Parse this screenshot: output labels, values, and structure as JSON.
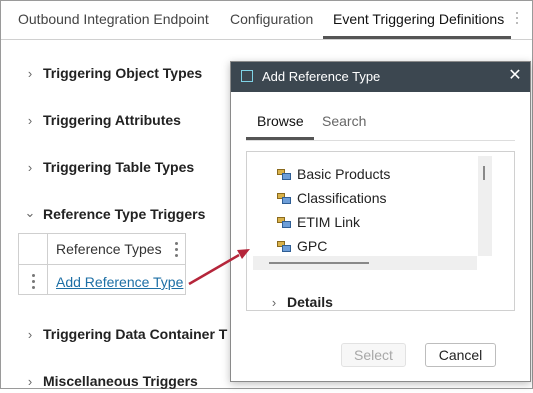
{
  "tabs": [
    {
      "label": "Outbound Integration Endpoint",
      "active": false
    },
    {
      "label": "Configuration",
      "active": false
    },
    {
      "label": "Event Triggering Definitions",
      "active": true
    }
  ],
  "sections": [
    {
      "label": "Triggering Object Types",
      "expanded": false
    },
    {
      "label": "Triggering Attributes",
      "expanded": false
    },
    {
      "label": "Triggering Table Types",
      "expanded": false
    },
    {
      "label": "Reference Type Triggers",
      "expanded": true
    },
    {
      "label": "Triggering Data Container T",
      "expanded": false
    },
    {
      "label": "Miscellaneous Triggers",
      "expanded": false
    }
  ],
  "icons": {
    "collapsed": "chevron-right-icon",
    "expanded": "chevron-down-icon",
    "chevron_collapsed_glyph": "›",
    "chevron_expanded_glyph": "⌄",
    "tree_item": "reference-type-icon",
    "kebab": "kebab-menu-icon"
  },
  "ref_table": {
    "header": "Reference Types",
    "add_link": "Add Reference Type"
  },
  "dialog": {
    "title": "Add Reference Type",
    "close_glyph": "✕",
    "tabs": [
      {
        "label": "Browse",
        "active": true
      },
      {
        "label": "Search",
        "active": false
      }
    ],
    "tree_items": [
      "Basic Products",
      "Classifications",
      "ETIM Link",
      "GPC"
    ],
    "details_label": "Details",
    "select_label": "Select",
    "cancel_label": "Cancel"
  },
  "colors": {
    "title_bar": "#3c4750",
    "link": "#1d6fa5",
    "annotation_arrow": "#b5253a"
  }
}
